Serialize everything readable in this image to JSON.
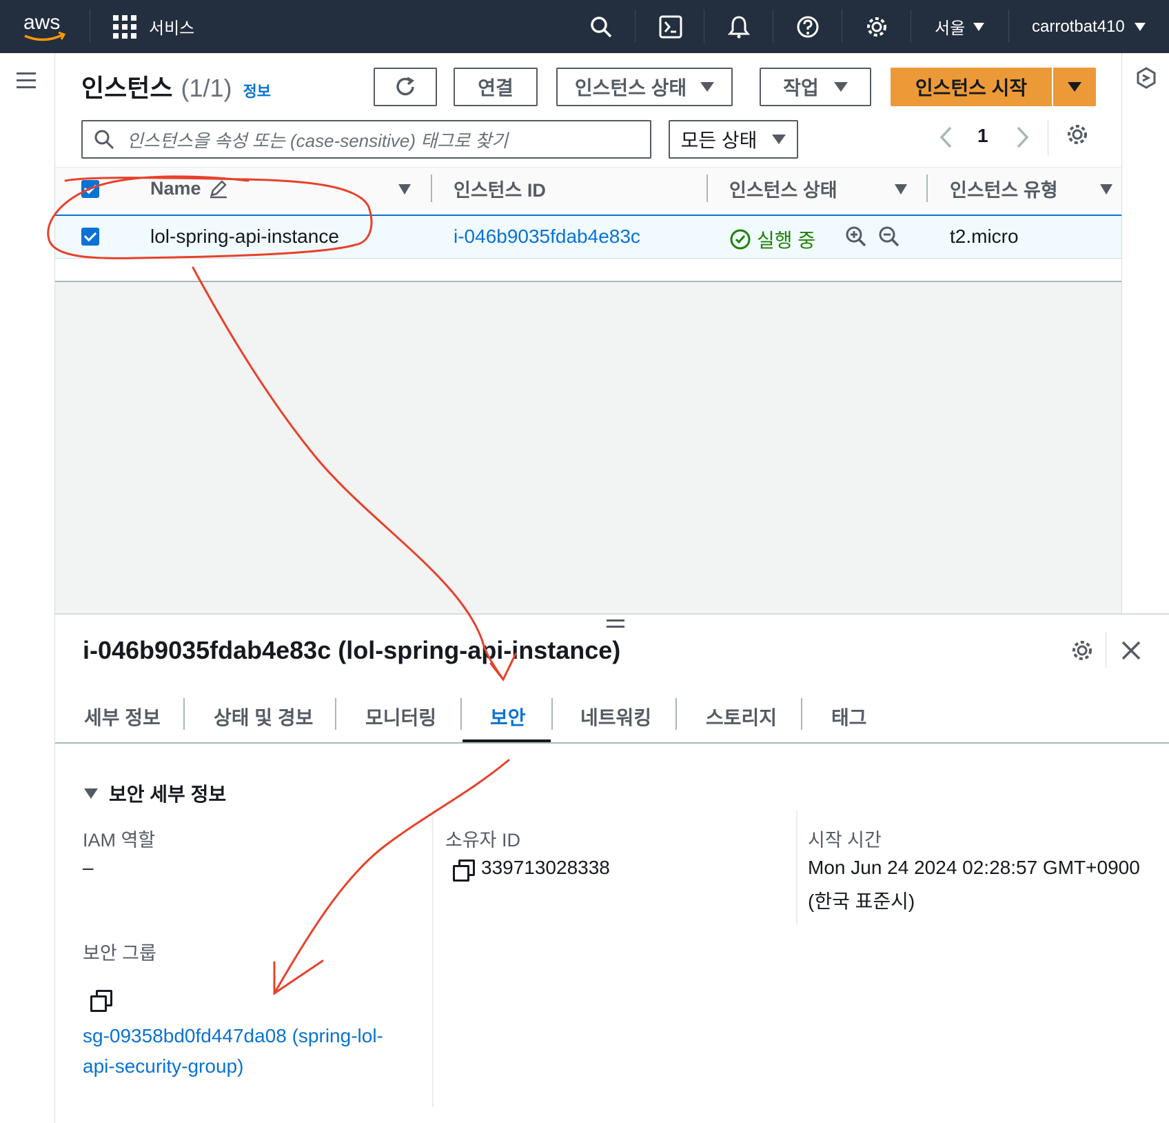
{
  "topnav": {
    "logo": "aws",
    "services_label": "서비스",
    "region_label": "서울",
    "account_label": "carrotbat410",
    "icons": [
      "search-icon",
      "cloudshell-icon",
      "bell-icon",
      "help-icon",
      "gear-icon"
    ]
  },
  "instances": {
    "title": "인스턴스",
    "count": "(1/1)",
    "info_link": "정보",
    "buttons": {
      "connect": "연결",
      "instance_state": "인스턴스 상태",
      "actions": "작업",
      "launch": "인스턴스 시작"
    },
    "search_placeholder": "인스턴스을 속성 또는 (case-sensitive) 태그로 찾기",
    "filter_state": "모든 상태",
    "page_number": "1",
    "columns": [
      "Name",
      "인스턴스 ID",
      "인스턴스 상태",
      "인스턴스 유형"
    ],
    "rows": [
      {
        "name": "lol-spring-api-instance",
        "instance_id": "i-046b9035fdab4e83c",
        "state": "실행 중",
        "type": "t2.micro"
      }
    ]
  },
  "detail": {
    "title": "i-046b9035fdab4e83c (lol-spring-api-instance)",
    "tabs": [
      "세부 정보",
      "상태 및 경보",
      "모니터링",
      "보안",
      "네트워킹",
      "스토리지",
      "태그"
    ],
    "active_tab": "보안",
    "section_title": "보안 세부 정보",
    "iam_role_label": "IAM 역할",
    "iam_role_value": "–",
    "owner_id_label": "소유자 ID",
    "owner_id_value": "339713028338",
    "launch_time_label": "시작 시간",
    "launch_time_line1": "Mon Jun 24 2024 02:28:57 GMT+0900",
    "launch_time_line2": "(한국 표준시)",
    "security_groups_label": "보안 그룹",
    "security_group_line1": "sg-09358bd0fd447da08 (spring-lol-",
    "security_group_line2": "api-security-group)"
  },
  "colors": {
    "nav_bg": "#232f3e",
    "accent_orange": "#ec9a37",
    "link_blue": "#0972d3",
    "running_green": "#1d8102",
    "annotation_red": "#e8402a"
  }
}
